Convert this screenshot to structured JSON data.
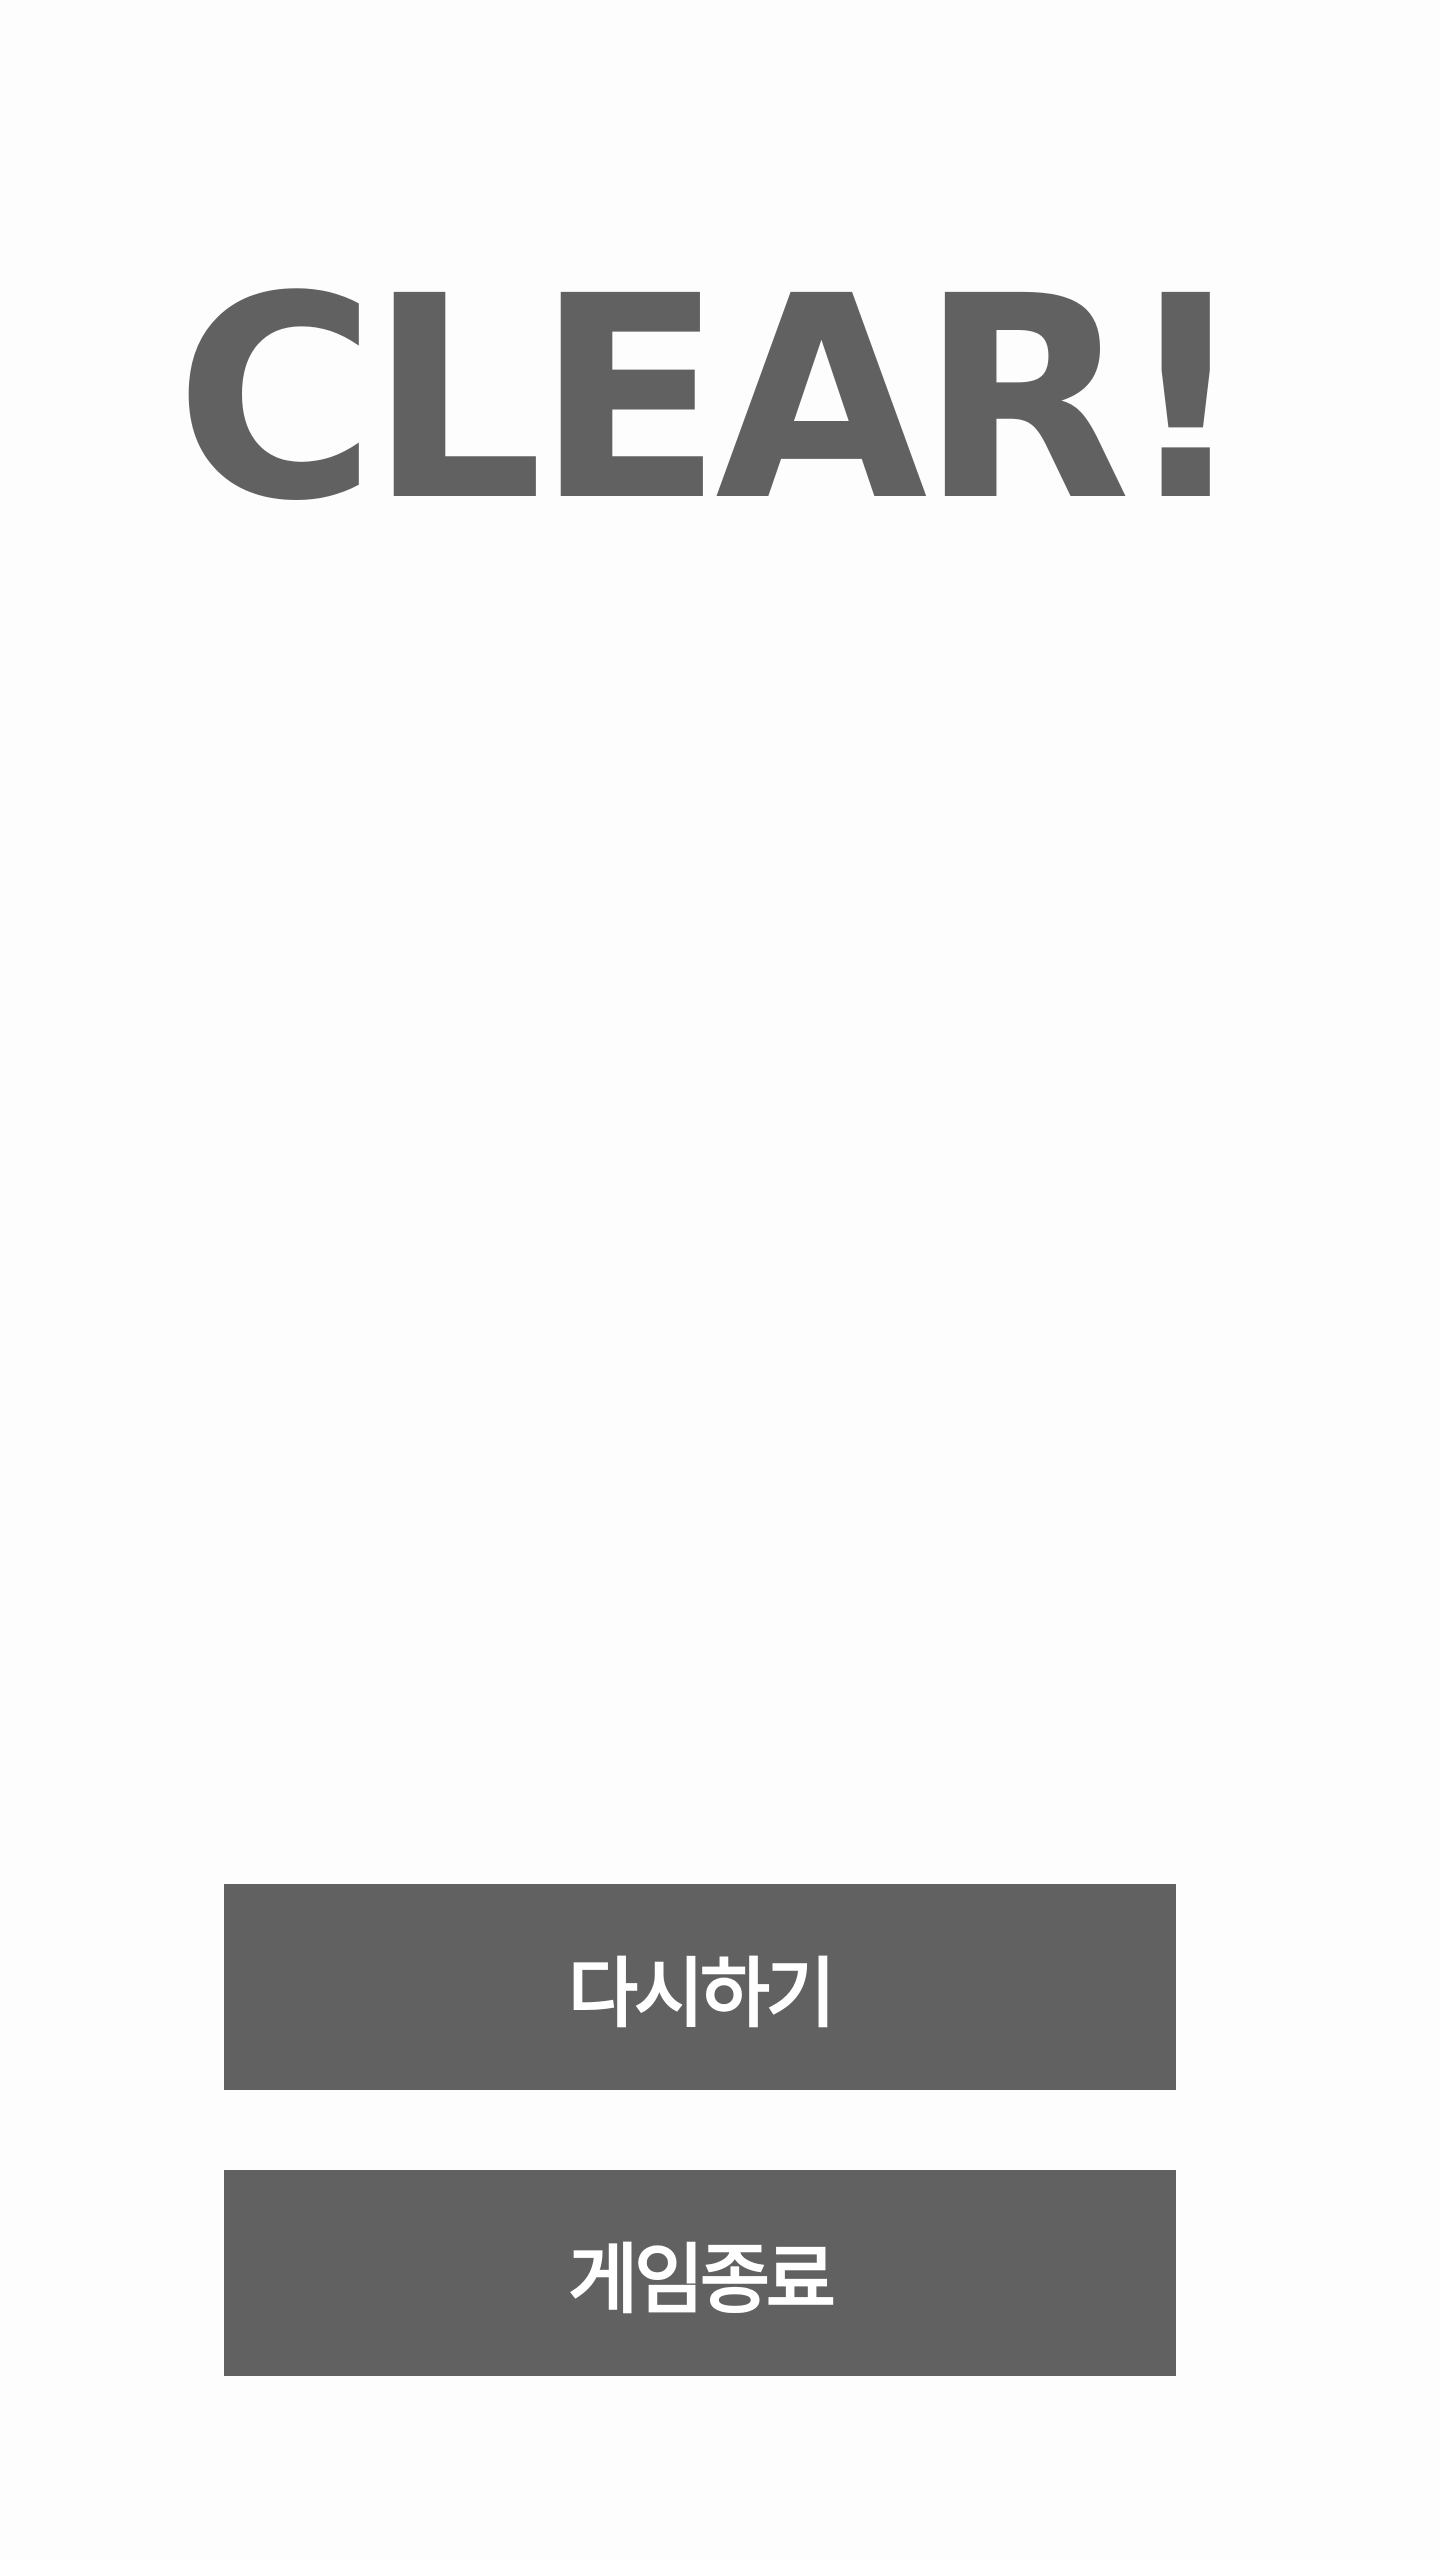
{
  "screen": {
    "title": "CLEAR!",
    "title_color": "#616161",
    "background_color": "#fdfdfd"
  },
  "buttons": {
    "restart_label": "다시하기",
    "quit_label": "게임종료",
    "color": "#616161",
    "text_color": "#ffffff"
  }
}
